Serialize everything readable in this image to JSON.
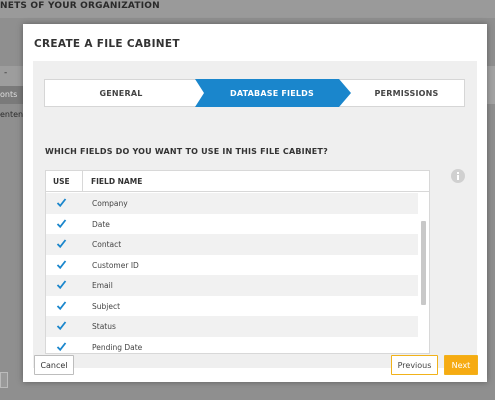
{
  "background": {
    "page_title": "NETS OF YOUR ORGANIZATION",
    "column_label": "-",
    "row_label": "onts",
    "row_text": "entenp"
  },
  "modal": {
    "title": "CREATE A FILE CABINET",
    "steps": [
      {
        "label": "GENERAL",
        "active": false
      },
      {
        "label": "DATABASE FIELDS",
        "active": true
      },
      {
        "label": "PERMISSIONS",
        "active": false
      }
    ],
    "question": "WHICH FIELDS DO YOU WANT TO USE IN THIS FILE CABINET?",
    "table": {
      "col_use": "USE",
      "col_name": "FIELD NAME",
      "rows": [
        {
          "checked": true,
          "name": "Company"
        },
        {
          "checked": true,
          "name": "Date"
        },
        {
          "checked": true,
          "name": "Contact"
        },
        {
          "checked": true,
          "name": "Customer ID"
        },
        {
          "checked": true,
          "name": "Email"
        },
        {
          "checked": true,
          "name": "Subject"
        },
        {
          "checked": true,
          "name": "Status"
        },
        {
          "checked": true,
          "name": "Pending Date"
        }
      ]
    },
    "buttons": {
      "cancel": "Cancel",
      "previous": "Previous",
      "next": "Next"
    }
  },
  "colors": {
    "active_step": "#1a86cc",
    "accent_orange": "#f6ab12",
    "checkmark": "#1a86cc"
  },
  "icons": {
    "info": "info-icon",
    "checkbox": "checkmark-icon"
  }
}
